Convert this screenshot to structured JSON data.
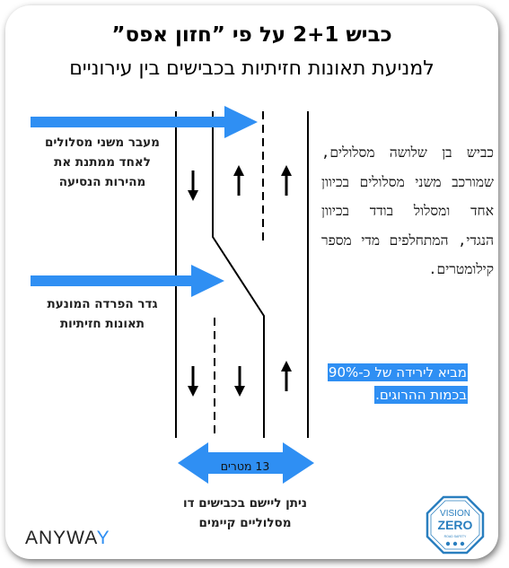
{
  "header": {
    "title": "כביש 2+1 על פי ”חזון אפס”",
    "subtitle": "למניעת תאונות חזיתיות בכבישים בין עירוניים"
  },
  "diagram": {
    "label_top": [
      "מעבר משני מסלולים",
      "לאחד ממתנת את",
      "מהירות הנסיעה"
    ],
    "label_barrier": [
      "גדר הפרדה המונעת",
      "תאונות חזיתיות"
    ],
    "width_label": "13 מטרים",
    "applicable": [
      "ניתן ליישם בכבישים דו",
      "מסלוליים קיימים"
    ]
  },
  "description": "כביש בן שלושה מסלולים, שמורכב משני מסלולים בכיוון אחד ומסלול בודד בכיוון הנגדי, המתחלפים מדי מספר קילומטרים.",
  "highlight": "מביא לירידה של כ-90% בכמות ההרוגים.",
  "brand": {
    "name": "ANYWAY",
    "main": "ANYWA",
    "accent": "Y"
  },
  "logo": {
    "line1": "VISION",
    "line2": "ZERO",
    "tagline": "ROAD SAFETY"
  },
  "colors": {
    "accent": "#2f8ff3",
    "logo_blue": "#2a7fbf"
  }
}
